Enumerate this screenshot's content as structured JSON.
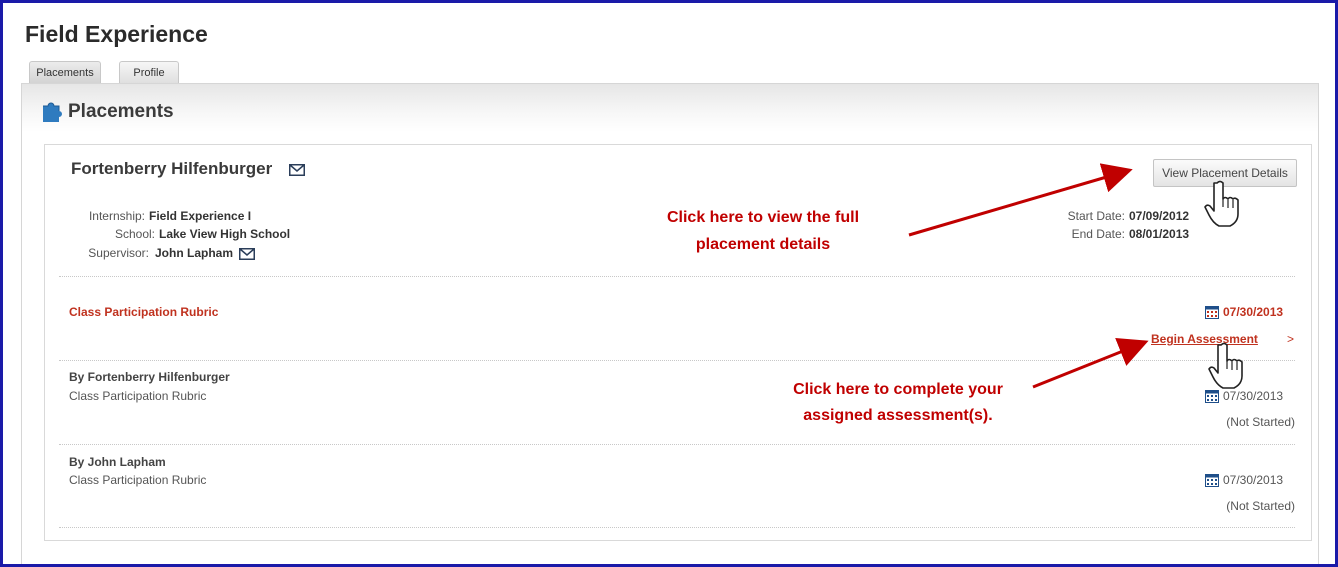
{
  "header": {
    "title": "Field Experience"
  },
  "tabs": [
    {
      "label": "Placements"
    },
    {
      "label": "Profile"
    }
  ],
  "panel": {
    "title": "Placements"
  },
  "placement": {
    "student_name": "Fortenberry Hilfenburger",
    "internship_label": "Internship:",
    "internship_value": "Field Experience I",
    "school_label": "School:",
    "school_value": "Lake View High School",
    "supervisor_label": "Supervisor:",
    "supervisor_value": "John Lapham",
    "start_label": "Start Date:",
    "start_value": "07/09/2012",
    "end_label": "End Date:",
    "end_value": "08/01/2013",
    "details_button": "View Placement Details"
  },
  "assessment": {
    "title": "Class Participation Rubric",
    "due_date": "07/30/2013",
    "begin_link": "Begin Assessment",
    "begin_arrow": ">"
  },
  "rows": [
    {
      "by": "By Fortenberry Hilfenburger",
      "sub": "Class Participation Rubric",
      "date": "07/30/2013",
      "status": "(Not Started)"
    },
    {
      "by": "By John Lapham",
      "sub": "Class Participation Rubric",
      "date": "07/30/2013",
      "status": "(Not Started)"
    }
  ],
  "annotations": {
    "details_1": "Click here to view the full",
    "details_2": "placement details",
    "assess_1": "Click here to complete your",
    "assess_2": "assigned assessment(s)."
  },
  "colors": {
    "accent_red": "#c0321f",
    "annotation_red": "#c00000",
    "frame_blue": "#1a1aa8",
    "icon_blue": "#2f7bbf"
  },
  "icons": [
    "puzzle-icon",
    "mail-icon",
    "calendar-icon",
    "hand-pointer-icon"
  ]
}
